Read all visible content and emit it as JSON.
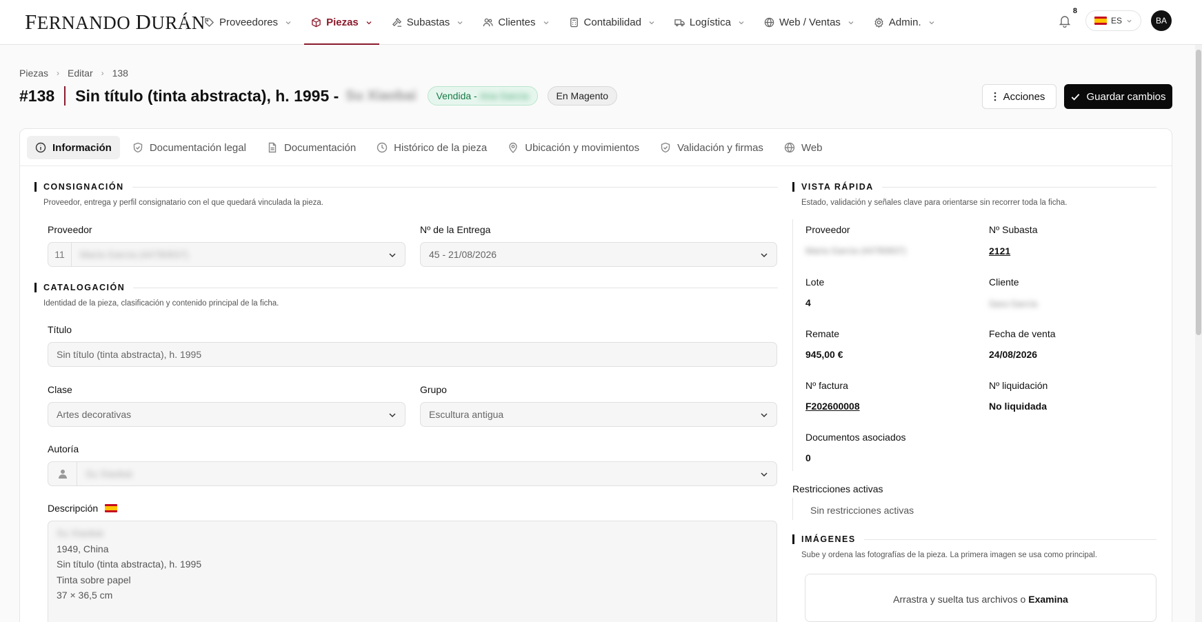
{
  "brand": "Fernando Durán",
  "nav": {
    "items": [
      {
        "label": "Proveedores",
        "icon": "tag-icon"
      },
      {
        "label": "Piezas",
        "icon": "cube-icon",
        "active": true
      },
      {
        "label": "Subastas",
        "icon": "gavel-icon"
      },
      {
        "label": "Clientes",
        "icon": "users-icon"
      },
      {
        "label": "Contabilidad",
        "icon": "calculator-icon"
      },
      {
        "label": "Logística",
        "icon": "truck-icon"
      },
      {
        "label": "Web / Ventas",
        "icon": "globe-icon"
      },
      {
        "label": "Admin.",
        "icon": "gear-icon"
      }
    ],
    "notifications": "8",
    "lang": "ES",
    "avatar": "BA"
  },
  "breadcrumb": [
    "Piezas",
    "Editar",
    "138"
  ],
  "header": {
    "id": "#138",
    "title": "Sin título (tinta abstracta), h. 1995 -",
    "author_blurred": "Su Xiaobai",
    "status_badge": "Vendida -",
    "status_badge_blurred": "Ana García",
    "magento_badge": "En Magento",
    "actions_label": "Acciones",
    "save_label": "Guardar cambios"
  },
  "tabs": [
    {
      "label": "Información",
      "icon": "info-icon",
      "active": true
    },
    {
      "label": "Documentación legal",
      "icon": "shield-icon"
    },
    {
      "label": "Documentación",
      "icon": "file-icon"
    },
    {
      "label": "Histórico de la pieza",
      "icon": "clock-icon"
    },
    {
      "label": "Ubicación y movimientos",
      "icon": "pin-icon"
    },
    {
      "label": "Validación y firmas",
      "icon": "shield-check-icon"
    },
    {
      "label": "Web",
      "icon": "globe-icon"
    }
  ],
  "consignacion": {
    "title": "CONSIGNACIÓN",
    "desc": "Proveedor, entrega y perfil consignatario con el que quedará vinculada la pieza.",
    "proveedor_label": "Proveedor",
    "proveedor_id": "11",
    "proveedor_blurred": "María García (44780837)",
    "entrega_label": "Nº de la Entrega",
    "entrega_value": "45 - 21/08/2026"
  },
  "catalogacion": {
    "title": "CATALOGACIÓN",
    "desc": "Identidad de la pieza, clasificación y contenido principal de la ficha.",
    "titulo_label": "Título",
    "titulo_value": "Sin título (tinta abstracta), h. 1995",
    "clase_label": "Clase",
    "clase_value": "Artes decorativas",
    "grupo_label": "Grupo",
    "grupo_value": "Escultura antigua",
    "autoria_label": "Autoría",
    "autoria_blurred": "Su Xiaobai",
    "descripcion_label": "Descripción",
    "descripcion_blurred": "Su Xiaobai",
    "descripcion_lines": [
      "1949, China",
      "Sin título (tinta abstracta), h. 1995",
      "Tinta sobre papel",
      "37 × 36,5 cm"
    ]
  },
  "vista_rapida": {
    "title": "VISTA RÁPIDA",
    "desc": "Estado, validación y señales clave para orientarse sin recorrer toda la ficha.",
    "proveedor_label": "Proveedor",
    "proveedor_blurred": "María García (44780837)",
    "subasta_label": "Nº Subasta",
    "subasta_value": "2121",
    "lote_label": "Lote",
    "lote_value": "4",
    "cliente_label": "Cliente",
    "cliente_blurred": "Sara García",
    "remate_label": "Remate",
    "remate_value": "945,00 €",
    "fecha_label": "Fecha de venta",
    "fecha_value": "24/08/2026",
    "factura_label": "Nº factura",
    "factura_value": "F202600008",
    "liquidacion_label": "Nº liquidación",
    "liquidacion_value": "No liquidada",
    "docs_label": "Documentos asociados",
    "docs_value": "0",
    "restricciones_label": "Restricciones activas",
    "restricciones_value": "Sin restricciones activas"
  },
  "imagenes": {
    "title": "IMÁGENES",
    "desc": "Sube y ordena las fotografías de la pieza. La primera imagen se usa como principal.",
    "drop_text": "Arrastra y suelta tus archivos o",
    "drop_link": "Examina"
  }
}
